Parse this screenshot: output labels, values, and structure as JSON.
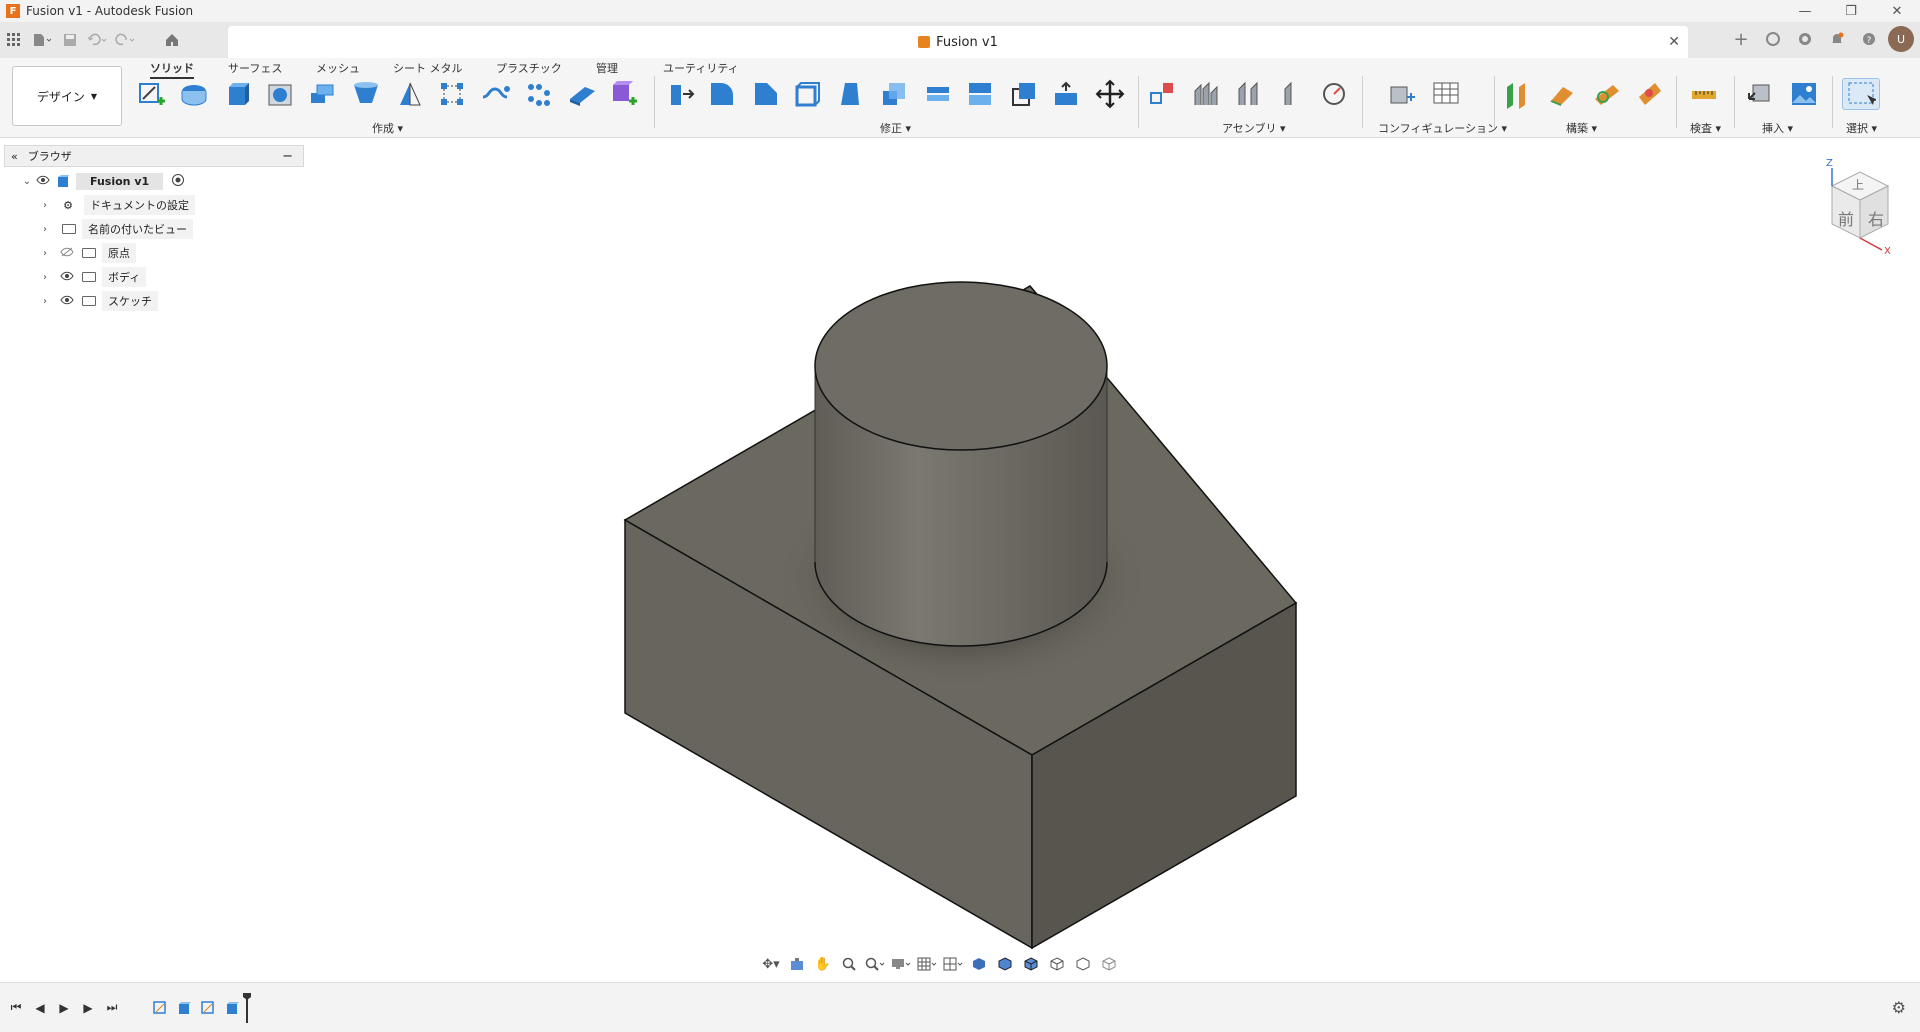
{
  "window": {
    "title": "Fusion v1 - Autodesk Fusion",
    "logo_letter": "F",
    "minimize": "—",
    "restore": "❐",
    "close": "✕"
  },
  "quick_access": {
    "apps_icon": "grid-icon",
    "file_icon": "file-icon",
    "save_icon": "save-icon",
    "undo_icon": "undo-icon",
    "redo_icon": "redo-icon",
    "home_icon": "home-icon"
  },
  "doc_tab": {
    "label": "Fusion v1",
    "close": "✕"
  },
  "header_right": {
    "new_tab": "+",
    "avatar": "U"
  },
  "workspace": {
    "label": "デザイン"
  },
  "ribbon_tabs": [
    "ソリッド",
    "サーフェス",
    "メッシュ",
    "シート メタル",
    "プラスチック",
    "管理",
    "ユーティリティ"
  ],
  "ribbon_groups": {
    "create": "作成",
    "modify": "修正",
    "assemble": "アセンブリ",
    "config": "コンフィギュレーション",
    "construct": "構築",
    "inspect": "検査",
    "insert": "挿入",
    "select": "選択"
  },
  "browser": {
    "title": "ブラウザ",
    "collapse": "−",
    "root": "Fusion v1",
    "items": [
      "ドキュメントの設定",
      "名前の付いたビュー",
      "原点",
      "ボディ",
      "スケッチ"
    ]
  },
  "viewcube": {
    "top": "上",
    "front": "前",
    "right": "右",
    "axis_z": "Z",
    "axis_x": "X"
  },
  "colors": {
    "accent_blue": "#2f7fd0",
    "accent_orange": "#e8821c",
    "model_face_light": "#6d6b63",
    "model_face_dark": "#57554e"
  }
}
